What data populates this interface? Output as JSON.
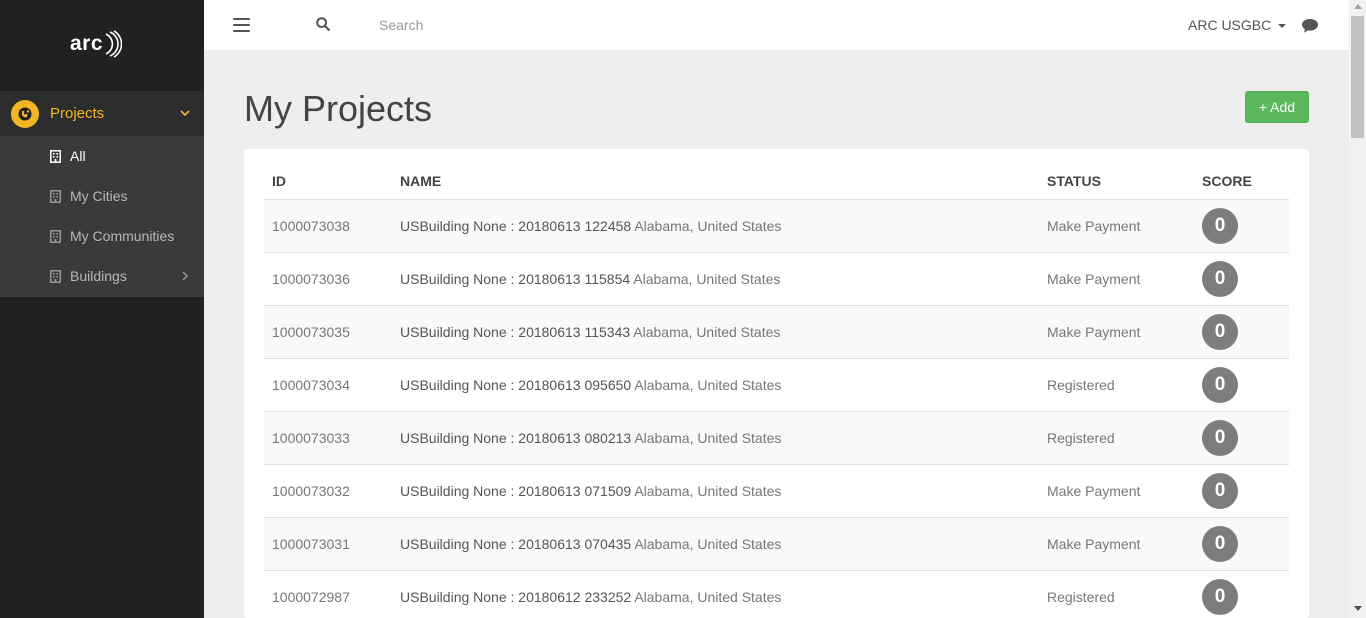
{
  "app": {
    "logo_text": "arc"
  },
  "sidebar": {
    "projects_label": "Projects",
    "items": [
      {
        "label": "All",
        "active": true,
        "has_chevron": false
      },
      {
        "label": "My Cities",
        "active": false,
        "has_chevron": false
      },
      {
        "label": "My Communities",
        "active": false,
        "has_chevron": false
      },
      {
        "label": "Buildings",
        "active": false,
        "has_chevron": true
      }
    ]
  },
  "topbar": {
    "search_placeholder": "Search",
    "account_name": "ARC USGBC"
  },
  "main": {
    "title": "My Projects",
    "add_label": "+ Add"
  },
  "table": {
    "headers": {
      "id": "ID",
      "name": "NAME",
      "status": "STATUS",
      "score": "SCORE"
    },
    "rows": [
      {
        "id": "1000073038",
        "name": "USBuilding None : 20180613 122458",
        "location": "Alabama, United States",
        "status": "Make Payment",
        "score": "0"
      },
      {
        "id": "1000073036",
        "name": "USBuilding None : 20180613 115854",
        "location": "Alabama, United States",
        "status": "Make Payment",
        "score": "0"
      },
      {
        "id": "1000073035",
        "name": "USBuilding None : 20180613 115343",
        "location": "Alabama, United States",
        "status": "Make Payment",
        "score": "0"
      },
      {
        "id": "1000073034",
        "name": "USBuilding None : 20180613 095650",
        "location": "Alabama, United States",
        "status": "Registered",
        "score": "0"
      },
      {
        "id": "1000073033",
        "name": "USBuilding None : 20180613 080213",
        "location": "Alabama, United States",
        "status": "Registered",
        "score": "0"
      },
      {
        "id": "1000073032",
        "name": "USBuilding None : 20180613 071509",
        "location": "Alabama, United States",
        "status": "Make Payment",
        "score": "0"
      },
      {
        "id": "1000073031",
        "name": "USBuilding None : 20180613 070435",
        "location": "Alabama, United States",
        "status": "Make Payment",
        "score": "0"
      },
      {
        "id": "1000072987",
        "name": "USBuilding None : 20180612 233252",
        "location": "Alabama, United States",
        "status": "Registered",
        "score": "0"
      }
    ]
  },
  "colors": {
    "sidebar_bg": "#212121",
    "accent": "#f3b625",
    "add_button": "#5cb85c",
    "score_circle": "#7d7d7d"
  },
  "icons": {
    "logo": "arc-logo-waves",
    "projects": "globe-icon",
    "building": "building-icon",
    "menu": "hamburger-icon",
    "search": "search-icon",
    "chat": "chat-bubble-icon"
  }
}
